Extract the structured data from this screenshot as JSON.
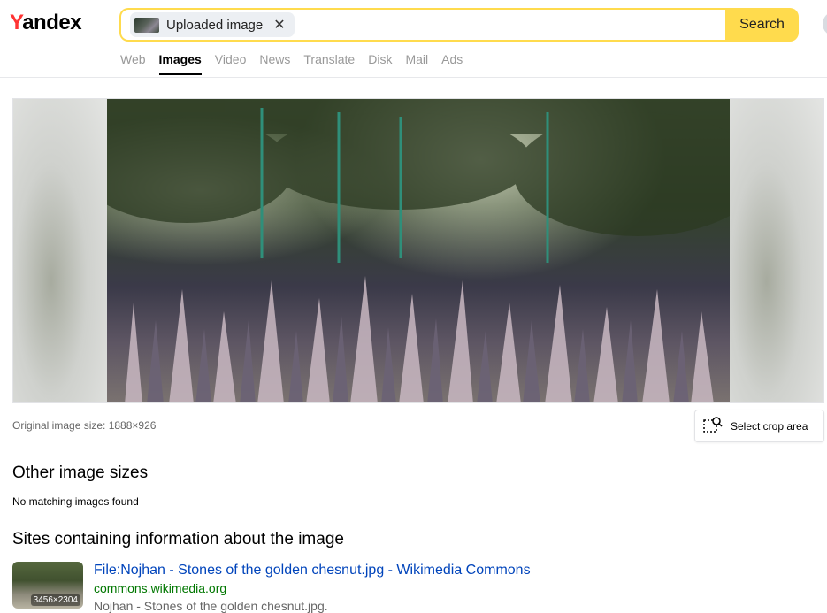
{
  "header": {
    "logo": "Yandex",
    "logo_first": "Y",
    "logo_rest": "andex",
    "search": {
      "chip_label": "Uploaded image",
      "clear_symbol": "✕",
      "button_label": "Search"
    },
    "tabs": [
      {
        "label": "Web",
        "active": false
      },
      {
        "label": "Images",
        "active": true
      },
      {
        "label": "Video",
        "active": false
      },
      {
        "label": "News",
        "active": false
      },
      {
        "label": "Translate",
        "active": false
      },
      {
        "label": "Disk",
        "active": false
      },
      {
        "label": "Mail",
        "active": false
      },
      {
        "label": "Ads",
        "active": false
      }
    ]
  },
  "preview": {
    "original_size_text": "Original image size: 1888×926",
    "crop_button_label": "Select crop area",
    "crop_icon": "crop-search-icon"
  },
  "other_sizes": {
    "heading": "Other image sizes",
    "empty_text": "No matching images found"
  },
  "sites": {
    "heading": "Sites containing information about the image",
    "results": [
      {
        "thumb_dims": "3456×2304",
        "title": "File:Nojhan - Stones of the golden chesnut.jpg - Wikimedia Commons",
        "url": "commons.wikimedia.org",
        "snippet": "Nojhan - Stones of the golden chesnut.jpg."
      }
    ]
  },
  "colors": {
    "search_accent": "#ffdb4d",
    "logo_red": "#ff3333",
    "link_blue": "#0044bb",
    "url_green": "#007700"
  }
}
